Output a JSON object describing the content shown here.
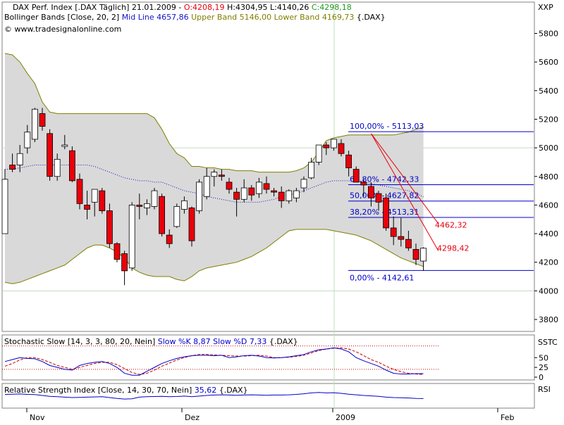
{
  "header": {
    "line1": {
      "prefix": "DAX Perf. Index [.DAX  Täglich] 21.01.2009 - ",
      "open": "O:4208,19",
      "high": " H:4304,95",
      "low": " L:4140,26",
      "close": " C:4298,18"
    },
    "line2": {
      "prefix": "Bollinger Bands [Close, 20, 2] ",
      "mid": "Mid Line 4657,86",
      "upper": " Upper Band 5146,00",
      "lower": " Lower Band 4169,73",
      "suffix": " {.DAX}"
    },
    "line3": "© www.tradesignalonline.com"
  },
  "colors": {
    "up_body": "#ffffff",
    "down_body": "#e8000b",
    "band_fill": "#d9d9d9",
    "band_line": "#7f7f00",
    "mid_line": "#1414c8",
    "fib_line": "#0000cc",
    "trend_line": "#e8000b",
    "grid": "#bfdcbf",
    "stoch_k": "#0000cc",
    "stoch_d": "#c80000",
    "rsi_line": "#0000cc"
  },
  "price_axis": {
    "label": "XXP",
    "ticks": [
      "5800",
      "5600",
      "5400",
      "5200",
      "5000",
      "4800",
      "4600",
      "4400",
      "4200",
      "4000",
      "3800"
    ]
  },
  "x_axis": {
    "ticks": [
      "Nov",
      "Dez",
      "2009",
      "Feb"
    ]
  },
  "fib_levels": [
    {
      "label": "100,00% - 5113,03",
      "value": 5113.03
    },
    {
      "label": "61,80% - 4742,33",
      "value": 4742.33
    },
    {
      "label": "50,00% - 4627,82",
      "value": 4627.82
    },
    {
      "label": "38,20% - 4513,31",
      "value": 4513.31
    },
    {
      "label": "0,00% - 4142,61",
      "value": 4142.61
    }
  ],
  "trend_labels": {
    "upper": "4462,32",
    "last": "4298,42"
  },
  "stoch_panel": {
    "title_prefix": "Stochastic Slow [14, 3, 3, 80, 20, Nein] ",
    "title_values": "Slow %K 8,87 Slow %D 7,33",
    "title_suffix": " {.DAX}",
    "axis_label": "SSTC",
    "ticks": [
      "50",
      "25",
      "0"
    ]
  },
  "rsi_panel": {
    "title_prefix": "Relative Strength Index [Close, 14, 30, 70, Nein] ",
    "title_value": "35,62",
    "title_suffix": " {.DAX}",
    "axis_label": "RSI"
  },
  "chart_data": {
    "type": "candlestick",
    "title": "DAX Perf. Index [.DAX  Täglich]",
    "ylim": [
      3700,
      5950
    ],
    "candles": [
      {
        "o": 4400,
        "h": 4850,
        "l": 4400,
        "c": 4780
      },
      {
        "o": 4880,
        "h": 4960,
        "l": 4830,
        "c": 4850
      },
      {
        "o": 4880,
        "h": 5020,
        "l": 4830,
        "c": 4960
      },
      {
        "o": 5000,
        "h": 5160,
        "l": 4960,
        "c": 5110
      },
      {
        "o": 5060,
        "h": 5280,
        "l": 5040,
        "c": 5270
      },
      {
        "o": 5240,
        "h": 5280,
        "l": 5120,
        "c": 5150
      },
      {
        "o": 5100,
        "h": 5130,
        "l": 4770,
        "c": 4800
      },
      {
        "o": 4800,
        "h": 4960,
        "l": 4770,
        "c": 4920
      },
      {
        "o": 5010,
        "h": 5090,
        "l": 4990,
        "c": 5020
      },
      {
        "o": 4980,
        "h": 5010,
        "l": 4760,
        "c": 4770
      },
      {
        "o": 4780,
        "h": 4820,
        "l": 4570,
        "c": 4610
      },
      {
        "o": 4600,
        "h": 4700,
        "l": 4500,
        "c": 4570
      },
      {
        "o": 4620,
        "h": 4680,
        "l": 4520,
        "c": 4710
      },
      {
        "o": 4700,
        "h": 4720,
        "l": 4540,
        "c": 4560
      },
      {
        "o": 4560,
        "h": 4610,
        "l": 4300,
        "c": 4330
      },
      {
        "o": 4330,
        "h": 4340,
        "l": 4200,
        "c": 4220
      },
      {
        "o": 4260,
        "h": 4280,
        "l": 4040,
        "c": 4140
      },
      {
        "o": 4160,
        "h": 4620,
        "l": 4140,
        "c": 4600
      },
      {
        "o": 4600,
        "h": 4680,
        "l": 4500,
        "c": 4590
      },
      {
        "o": 4580,
        "h": 4640,
        "l": 4530,
        "c": 4610
      },
      {
        "o": 4590,
        "h": 4720,
        "l": 4570,
        "c": 4700
      },
      {
        "o": 4660,
        "h": 4680,
        "l": 4380,
        "c": 4400
      },
      {
        "o": 4390,
        "h": 4430,
        "l": 4300,
        "c": 4330
      },
      {
        "o": 4450,
        "h": 4610,
        "l": 4440,
        "c": 4590
      },
      {
        "o": 4570,
        "h": 4660,
        "l": 4540,
        "c": 4630
      },
      {
        "o": 4580,
        "h": 4590,
        "l": 4310,
        "c": 4350
      },
      {
        "o": 4560,
        "h": 4780,
        "l": 4540,
        "c": 4760
      },
      {
        "o": 4660,
        "h": 4860,
        "l": 4640,
        "c": 4800
      },
      {
        "o": 4800,
        "h": 4850,
        "l": 4730,
        "c": 4830
      },
      {
        "o": 4810,
        "h": 4850,
        "l": 4770,
        "c": 4800
      },
      {
        "o": 4760,
        "h": 4790,
        "l": 4680,
        "c": 4710
      },
      {
        "o": 4690,
        "h": 4720,
        "l": 4520,
        "c": 4640
      },
      {
        "o": 4640,
        "h": 4780,
        "l": 4620,
        "c": 4720
      },
      {
        "o": 4720,
        "h": 4740,
        "l": 4630,
        "c": 4670
      },
      {
        "o": 4680,
        "h": 4790,
        "l": 4650,
        "c": 4760
      },
      {
        "o": 4750,
        "h": 4800,
        "l": 4680,
        "c": 4710
      },
      {
        "o": 4700,
        "h": 4720,
        "l": 4660,
        "c": 4690
      },
      {
        "o": 4690,
        "h": 4730,
        "l": 4580,
        "c": 4630
      },
      {
        "o": 4630,
        "h": 4710,
        "l": 4610,
        "c": 4700
      },
      {
        "o": 4650,
        "h": 4720,
        "l": 4620,
        "c": 4700
      },
      {
        "o": 4720,
        "h": 4800,
        "l": 4690,
        "c": 4780
      },
      {
        "o": 4790,
        "h": 4930,
        "l": 4780,
        "c": 4900
      },
      {
        "o": 4900,
        "h": 5000,
        "l": 4880,
        "c": 5020
      },
      {
        "o": 5020,
        "h": 5040,
        "l": 4950,
        "c": 5000
      },
      {
        "o": 5000,
        "h": 5060,
        "l": 4980,
        "c": 5060
      },
      {
        "o": 5030,
        "h": 5060,
        "l": 4940,
        "c": 4960
      },
      {
        "o": 4950,
        "h": 4980,
        "l": 4800,
        "c": 4860
      },
      {
        "o": 4850,
        "h": 4870,
        "l": 4760,
        "c": 4760
      },
      {
        "o": 4760,
        "h": 4780,
        "l": 4660,
        "c": 4740
      },
      {
        "o": 4730,
        "h": 4760,
        "l": 4590,
        "c": 4650
      },
      {
        "o": 4680,
        "h": 4700,
        "l": 4560,
        "c": 4620
      },
      {
        "o": 4650,
        "h": 4680,
        "l": 4420,
        "c": 4440
      },
      {
        "o": 4440,
        "h": 4520,
        "l": 4320,
        "c": 4380
      },
      {
        "o": 4380,
        "h": 4510,
        "l": 4310,
        "c": 4360
      },
      {
        "o": 4360,
        "h": 4420,
        "l": 4280,
        "c": 4300
      },
      {
        "o": 4290,
        "h": 4330,
        "l": 4180,
        "c": 4220
      },
      {
        "o": 4208.19,
        "h": 4304.95,
        "l": 4140.26,
        "c": 4298.18
      }
    ],
    "bollinger": {
      "upper": [
        5660,
        5650,
        5600,
        5520,
        5450,
        5320,
        5250,
        5240,
        5240,
        5240,
        5240,
        5240,
        5240,
        5240,
        5240,
        5240,
        5240,
        5240,
        5240,
        5240,
        5210,
        5130,
        5030,
        4960,
        4930,
        4870,
        4870,
        4860,
        4860,
        4850,
        4850,
        4840,
        4840,
        4840,
        4830,
        4830,
        4830,
        4830,
        4830,
        4840,
        4860,
        4900,
        4970,
        5050,
        5070,
        5080,
        5090,
        5090,
        5090,
        5090,
        5090,
        5090,
        5090,
        5100,
        5110,
        5130,
        5146
      ],
      "mid": [
        4850,
        4850,
        4860,
        4870,
        4880,
        4880,
        4880,
        4880,
        4880,
        4880,
        4880,
        4880,
        4870,
        4850,
        4830,
        4810,
        4790,
        4780,
        4770,
        4770,
        4760,
        4760,
        4740,
        4720,
        4700,
        4690,
        4680,
        4660,
        4650,
        4640,
        4630,
        4620,
        4620,
        4620,
        4620,
        4630,
        4640,
        4660,
        4670,
        4680,
        4700,
        4720,
        4740,
        4760,
        4770,
        4770,
        4770,
        4770,
        4760,
        4750,
        4740,
        4730,
        4720,
        4710,
        4700,
        4680,
        4658
      ],
      "lower": [
        4060,
        4050,
        4060,
        4080,
        4100,
        4120,
        4140,
        4160,
        4180,
        4220,
        4260,
        4300,
        4320,
        4320,
        4300,
        4270,
        4230,
        4160,
        4130,
        4110,
        4100,
        4100,
        4100,
        4080,
        4070,
        4100,
        4140,
        4160,
        4170,
        4180,
        4190,
        4200,
        4220,
        4240,
        4270,
        4300,
        4340,
        4380,
        4420,
        4430,
        4430,
        4430,
        4430,
        4430,
        4420,
        4410,
        4400,
        4390,
        4370,
        4350,
        4320,
        4290,
        4260,
        4230,
        4210,
        4190,
        4170
      ]
    },
    "trend_lines": [
      {
        "x1": 49,
        "y1": 5100,
        "x2": 58,
        "y2": 4470
      },
      {
        "x1": 49,
        "y1": 5100,
        "x2": 58,
        "y2": 4280
      }
    ],
    "stochastic": {
      "k": [
        40,
        45,
        50,
        48,
        47,
        40,
        30,
        25,
        20,
        18,
        30,
        35,
        38,
        40,
        35,
        25,
        10,
        5,
        5,
        15,
        25,
        35,
        42,
        48,
        52,
        55,
        56,
        56,
        55,
        56,
        50,
        52,
        55,
        56,
        54,
        50,
        49,
        50,
        52,
        55,
        58,
        65,
        70,
        72,
        75,
        72,
        65,
        50,
        42,
        35,
        28,
        18,
        10,
        8,
        8,
        9,
        9
      ],
      "d": [
        28,
        35,
        44,
        50,
        50,
        45,
        38,
        30,
        25,
        20,
        25,
        30,
        35,
        38,
        38,
        32,
        22,
        12,
        7,
        10,
        18,
        28,
        36,
        44,
        50,
        55,
        58,
        58,
        57,
        56,
        55,
        54,
        54,
        55,
        56,
        54,
        50,
        50,
        51,
        53,
        56,
        62,
        68,
        72,
        74,
        75,
        72,
        65,
        55,
        45,
        38,
        28,
        20,
        14,
        10,
        8,
        7
      ],
      "levels": [
        80,
        20
      ]
    },
    "rsi": {
      "values": [
        55,
        56,
        57,
        55,
        54,
        50,
        46,
        44,
        42,
        40,
        41,
        42,
        43,
        44,
        40,
        36,
        33,
        34,
        42,
        44,
        45,
        46,
        44,
        45,
        47,
        44,
        47,
        50,
        52,
        53,
        52,
        51,
        52,
        53,
        52,
        51,
        52,
        52,
        53,
        55,
        58,
        62,
        64,
        62,
        63,
        60,
        56,
        53,
        50,
        48,
        46,
        42,
        40,
        39,
        38,
        36,
        35.62
      ],
      "levels": [
        70,
        30
      ]
    }
  }
}
